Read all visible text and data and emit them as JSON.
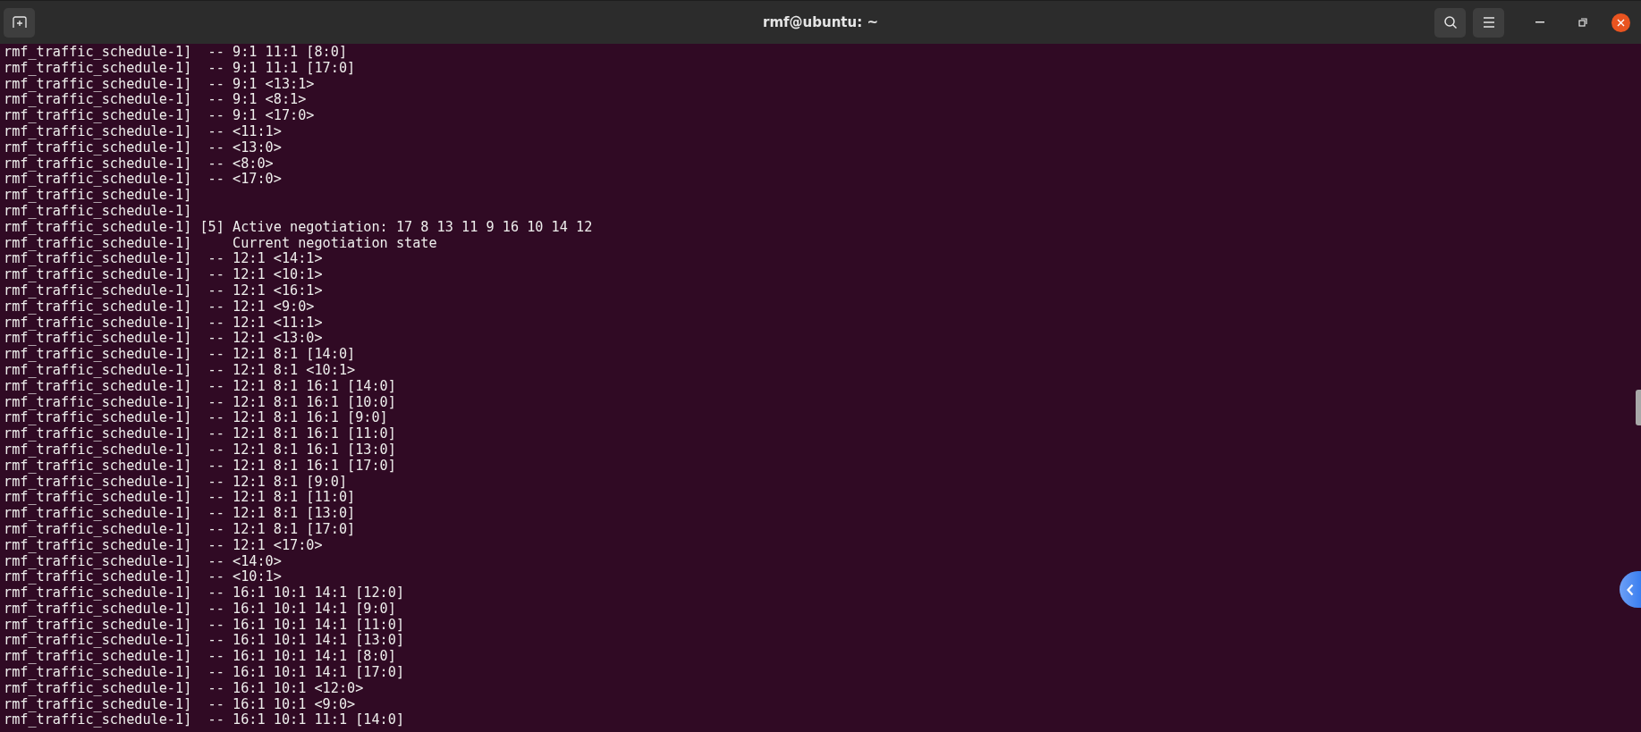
{
  "window": {
    "title": "rmf@ubuntu: ~"
  },
  "terminal": {
    "lines": [
      "rmf_traffic_schedule-1]  -- 9:1 11:1 [8:0]",
      "rmf_traffic_schedule-1]  -- 9:1 11:1 [17:0]",
      "rmf_traffic_schedule-1]  -- 9:1 <13:1>",
      "rmf_traffic_schedule-1]  -- 9:1 <8:1>",
      "rmf_traffic_schedule-1]  -- 9:1 <17:0>",
      "rmf_traffic_schedule-1]  -- <11:1>",
      "rmf_traffic_schedule-1]  -- <13:0>",
      "rmf_traffic_schedule-1]  -- <8:0>",
      "rmf_traffic_schedule-1]  -- <17:0>",
      "rmf_traffic_schedule-1]",
      "rmf_traffic_schedule-1]",
      "rmf_traffic_schedule-1] [5] Active negotiation: 17 8 13 11 9 16 10 14 12",
      "rmf_traffic_schedule-1]     Current negotiation state",
      "rmf_traffic_schedule-1]  -- 12:1 <14:1>",
      "rmf_traffic_schedule-1]  -- 12:1 <10:1>",
      "rmf_traffic_schedule-1]  -- 12:1 <16:1>",
      "rmf_traffic_schedule-1]  -- 12:1 <9:0>",
      "rmf_traffic_schedule-1]  -- 12:1 <11:1>",
      "rmf_traffic_schedule-1]  -- 12:1 <13:0>",
      "rmf_traffic_schedule-1]  -- 12:1 8:1 [14:0]",
      "rmf_traffic_schedule-1]  -- 12:1 8:1 <10:1>",
      "rmf_traffic_schedule-1]  -- 12:1 8:1 16:1 [14:0]",
      "rmf_traffic_schedule-1]  -- 12:1 8:1 16:1 [10:0]",
      "rmf_traffic_schedule-1]  -- 12:1 8:1 16:1 [9:0]",
      "rmf_traffic_schedule-1]  -- 12:1 8:1 16:1 [11:0]",
      "rmf_traffic_schedule-1]  -- 12:1 8:1 16:1 [13:0]",
      "rmf_traffic_schedule-1]  -- 12:1 8:1 16:1 [17:0]",
      "rmf_traffic_schedule-1]  -- 12:1 8:1 [9:0]",
      "rmf_traffic_schedule-1]  -- 12:1 8:1 [11:0]",
      "rmf_traffic_schedule-1]  -- 12:1 8:1 [13:0]",
      "rmf_traffic_schedule-1]  -- 12:1 8:1 [17:0]",
      "rmf_traffic_schedule-1]  -- 12:1 <17:0>",
      "rmf_traffic_schedule-1]  -- <14:0>",
      "rmf_traffic_schedule-1]  -- <10:1>",
      "rmf_traffic_schedule-1]  -- 16:1 10:1 14:1 [12:0]",
      "rmf_traffic_schedule-1]  -- 16:1 10:1 14:1 [9:0]",
      "rmf_traffic_schedule-1]  -- 16:1 10:1 14:1 [11:0]",
      "rmf_traffic_schedule-1]  -- 16:1 10:1 14:1 [13:0]",
      "rmf_traffic_schedule-1]  -- 16:1 10:1 14:1 [8:0]",
      "rmf_traffic_schedule-1]  -- 16:1 10:1 14:1 [17:0]",
      "rmf_traffic_schedule-1]  -- 16:1 10:1 <12:0>",
      "rmf_traffic_schedule-1]  -- 16:1 10:1 <9:0>",
      "rmf_traffic_schedule-1]  -- 16:1 10:1 11:1 [14:0]"
    ]
  }
}
